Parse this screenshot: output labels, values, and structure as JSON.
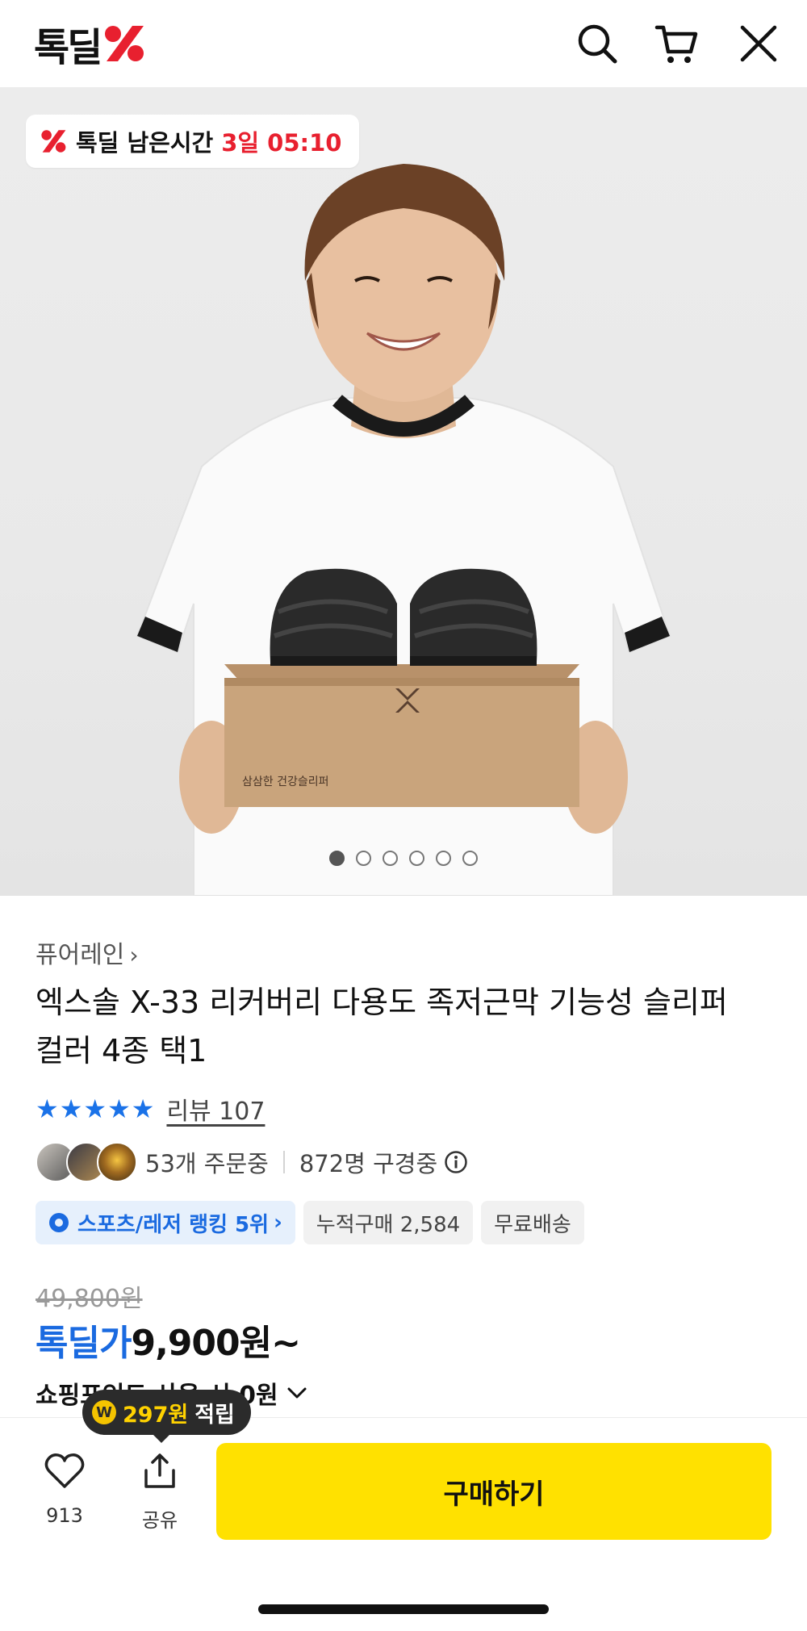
{
  "header": {
    "logo_text": "톡딜",
    "icons": [
      "search-icon",
      "cart-icon",
      "close-icon"
    ],
    "accent_color": "#e8202f"
  },
  "hero": {
    "timer_label": "톡딜 남은시간",
    "timer_value": "3일 05:10",
    "slide_count": 6,
    "active_slide": 1,
    "box_text": "삼삼한 건강슬리퍼"
  },
  "product": {
    "brand": "퓨어레인",
    "title_line1": "엑스솔 X-33 리커버리 다용도 족저근막 기능성 슬리퍼",
    "title_line2": "컬러 4종 택1",
    "rating_stars": 5,
    "review_label": "리뷰 107",
    "order_count": "53개 주문중",
    "subscriber_count": "872명 구경중",
    "tags": {
      "rank": "스포츠/레저 랭킹 5위",
      "cumulative": "누적구매 2,584",
      "shipping": "무료배송"
    },
    "original_price": "49,800원",
    "deal_label": "톡딜가",
    "deal_price": "9,900원~",
    "points_line": "쇼핑포인트 사용 시 0원"
  },
  "tooltip": {
    "amount": "297원",
    "earn_label": "적립"
  },
  "bottom_bar": {
    "like_count": "913",
    "share_label": "공유",
    "buy_label": "구매하기",
    "buy_color": "#ffe100",
    "deal_color": "#1a6ae0"
  }
}
